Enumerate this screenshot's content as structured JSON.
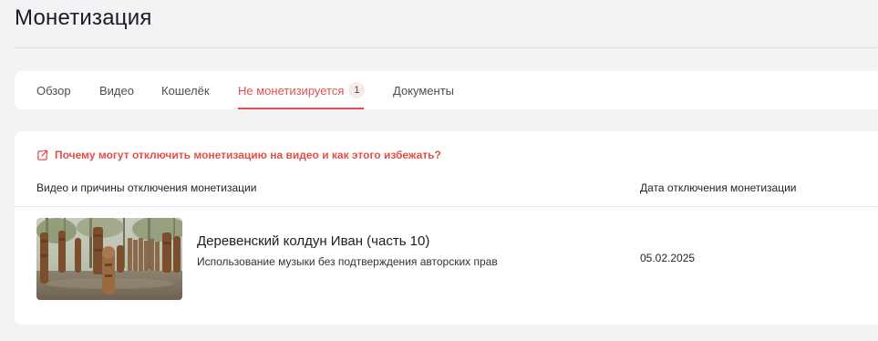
{
  "page": {
    "title": "Монетизация"
  },
  "tabs": [
    {
      "label": "Обзор",
      "active": false
    },
    {
      "label": "Видео",
      "active": false
    },
    {
      "label": "Кошелёк",
      "active": false
    },
    {
      "label": "Не монетизируется",
      "active": true,
      "badge": "1"
    },
    {
      "label": "Документы",
      "active": false
    }
  ],
  "help_link": {
    "label": "Почему могут отключить монетизацию на видео и как этого избежать?",
    "icon": "external-link-icon"
  },
  "table": {
    "columns": [
      "Видео и причины отключения монетизации",
      "Дата отключения монетизации"
    ],
    "rows": [
      {
        "title": "Деревенский колдун Иван (часть 10)",
        "reason": "Использование музыки без подтверждения авторских прав",
        "date": "05.02.2025"
      }
    ]
  },
  "colors": {
    "accent": "#e0504c",
    "page_bg": "#f2f3f5",
    "card_bg": "#ffffff"
  }
}
